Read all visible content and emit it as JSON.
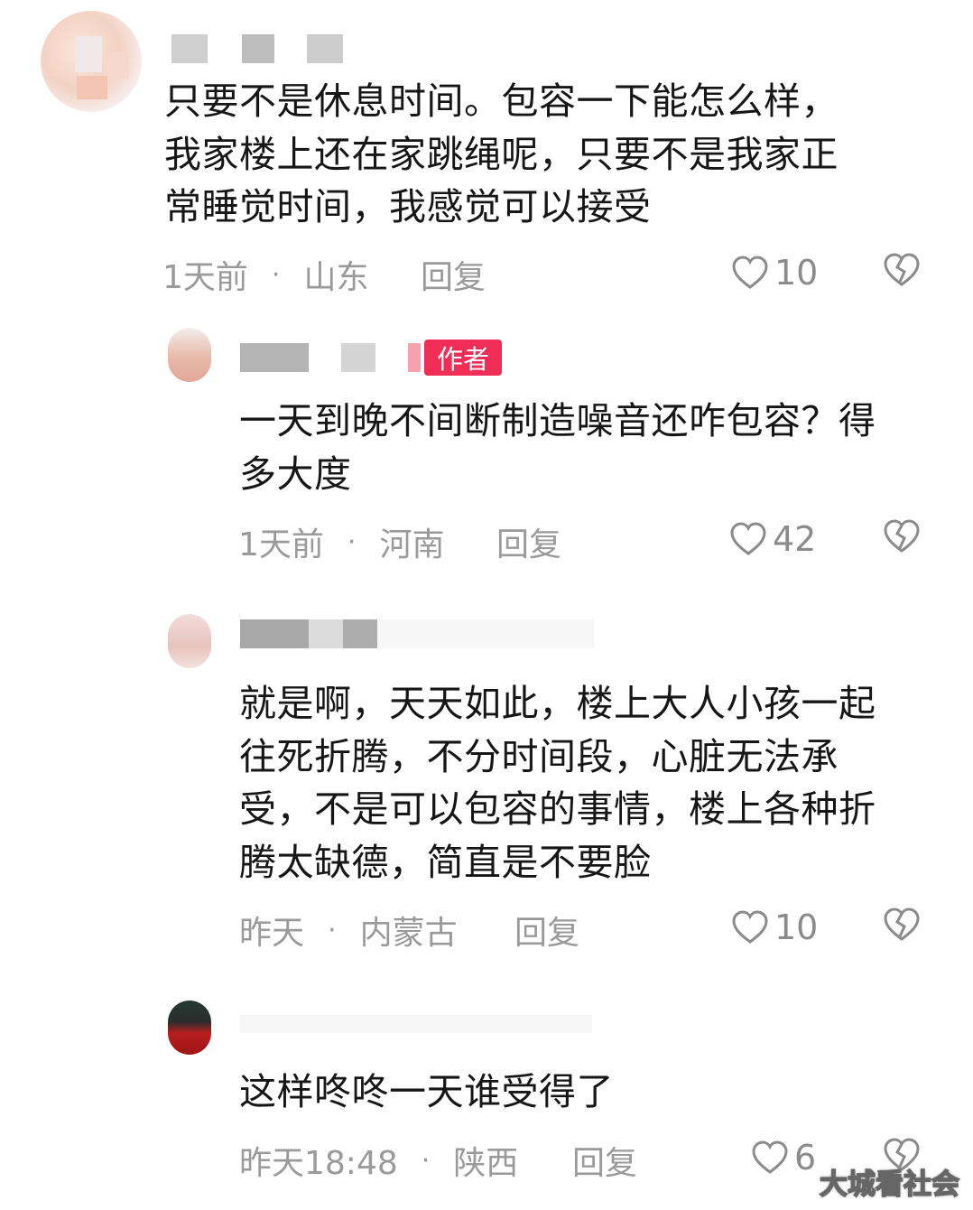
{
  "comments": [
    {
      "text": "只要不是休息时间。包容一下能怎么样，\n我家楼上还在家跳绳呢，只要不是我家正\n常睡觉时间，我感觉可以接受",
      "time": "1天前",
      "location": "山东",
      "reply_label": "回复",
      "likes": "10"
    },
    {
      "badge": "作者",
      "text": "一天到晚不间断制造噪音还咋包容？得\n多大度",
      "time": "1天前",
      "location": "河南",
      "reply_label": "回复",
      "likes": "42"
    },
    {
      "text": "就是啊，天天如此，楼上大人小孩一起\n往死折腾，不分时间段，心脏无法承\n受，不是可以包容的事情，楼上各种折\n腾太缺德，简直是不要脸",
      "time": "昨天",
      "location": "内蒙古",
      "reply_label": "回复",
      "likes": "10"
    },
    {
      "text": "这样咚咚一天谁受得了",
      "time": "昨天18:48",
      "location": "陕西",
      "reply_label": "回复",
      "likes": "6"
    }
  ],
  "separator": "·",
  "watermark": "大城看社会",
  "icons": {
    "like": "heart-outline-icon",
    "dislike": "broken-heart-icon"
  },
  "colors": {
    "author_badge": "#f02d56",
    "meta_text": "#9a9a9a"
  }
}
